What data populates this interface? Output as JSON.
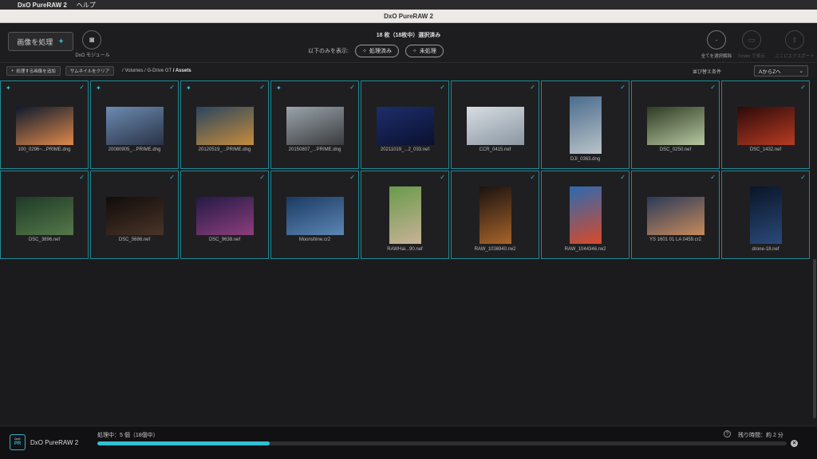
{
  "menubar": {
    "app": "DxO PureRAW 2",
    "help": "ヘルプ"
  },
  "window": {
    "title": "DxO PureRAW 2"
  },
  "toolbar": {
    "process_label": "画像を処理",
    "module_label": "DxO モジュール",
    "selection_count": "18 枚（18枚中）選択済み",
    "filter_label": "以下のみを表示:",
    "filter_processed": "処理済み",
    "filter_unprocessed": "未処理",
    "deselect_all": "全てを選択解除",
    "show_in_finder": "Finder で表示",
    "export_here": "ここにエクスポート"
  },
  "subbar": {
    "add_images": "処理する画像を追加",
    "clear_thumbnails": "サムネイルをクリア",
    "breadcrumb": [
      "/ Volumes",
      "/ G-Drive GT",
      "/ Assets"
    ],
    "sort_label": "並び替え条件",
    "sort_value": "AからZへ"
  },
  "colors": {
    "accent": "#2fc2d6",
    "tile_border": "#1f8a96"
  },
  "files": [
    {
      "name": "100_0296~...PRIME.dng",
      "processed": true,
      "c1": "#0d1a2e",
      "c2": "#e0894a",
      "orient": "land"
    },
    {
      "name": "20080905_...PRIME.dng",
      "processed": true,
      "c1": "#6c8bb2",
      "c2": "#2a3246",
      "orient": "land"
    },
    {
      "name": "20120519_...PRIME.dng",
      "processed": true,
      "c1": "#2a4560",
      "c2": "#c58c3a",
      "orient": "land"
    },
    {
      "name": "20150807_...PRIME.dng",
      "processed": true,
      "c1": "#9aa4ac",
      "c2": "#3a3b3d",
      "orient": "land"
    },
    {
      "name": "20211019_...2_033.nef",
      "processed": false,
      "c1": "#1d2e6a",
      "c2": "#0b1030",
      "orient": "land"
    },
    {
      "name": "CCR_0415.nef",
      "processed": false,
      "c1": "#d8dde2",
      "c2": "#8a96a2",
      "orient": "land"
    },
    {
      "name": "DJI_0363.dng",
      "processed": false,
      "c1": "#4a6c8e",
      "c2": "#b9c3c8",
      "orient": "port"
    },
    {
      "name": "DSC_0250.nef",
      "processed": false,
      "c1": "#2f3a22",
      "c2": "#b6c8a2",
      "orient": "land"
    },
    {
      "name": "DSC_1432.nef",
      "processed": false,
      "c1": "#2c0a0a",
      "c2": "#b83b22",
      "orient": "land"
    },
    {
      "name": "DSC_3896.nef",
      "processed": false,
      "c1": "#1d3a26",
      "c2": "#56784a",
      "orient": "land"
    },
    {
      "name": "DSC_5686.nef",
      "processed": false,
      "c1": "#100c0a",
      "c2": "#4a3428",
      "orient": "land"
    },
    {
      "name": "DSC_9638.nef",
      "processed": false,
      "c1": "#241a46",
      "c2": "#8c3e7c",
      "orient": "land"
    },
    {
      "name": "Moonshine.cr2",
      "processed": false,
      "c1": "#1a3a64",
      "c2": "#5c86b2",
      "orient": "land"
    },
    {
      "name": "RAWHai...90.nef",
      "processed": false,
      "c1": "#6a9a4a",
      "c2": "#c8b298",
      "orient": "port"
    },
    {
      "name": "RAW_1036940.rw2",
      "processed": false,
      "c1": "#1a1210",
      "c2": "#a8642a",
      "orient": "port"
    },
    {
      "name": "RAW_1044346.rw2",
      "processed": false,
      "c1": "#2c6ab2",
      "c2": "#d84a2a",
      "orient": "port"
    },
    {
      "name": "YS 1601 01 LA 0459.cr2",
      "processed": false,
      "c1": "#2a3a5a",
      "c2": "#c88a5a",
      "orient": "land"
    },
    {
      "name": "drone-18.nef",
      "processed": false,
      "c1": "#0a1426",
      "c2": "#2a4a7a",
      "orient": "port"
    }
  ],
  "status": {
    "app_name": "DxO PureRAW 2",
    "logo_top": "DxO",
    "logo_mark": "PR",
    "processing_text": "処理中：5 個（18個中）",
    "remaining_text": "残り時間：約 2 分",
    "progress_fraction": 0.25
  }
}
